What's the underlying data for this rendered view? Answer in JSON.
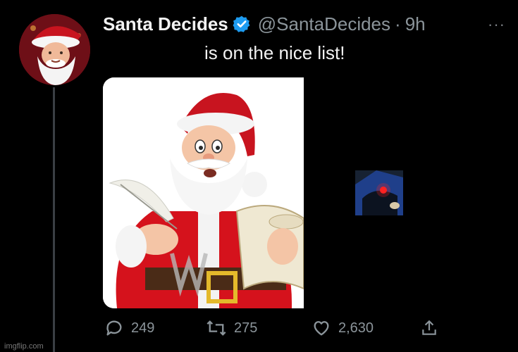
{
  "tweet": {
    "display_name": "Santa Decides",
    "handle": "@SantaDecides",
    "separator": "·",
    "time": "9h",
    "more_label": "···",
    "text": "is on the nice list!",
    "verified_icon": "verified-badge-icon"
  },
  "actions": {
    "replies": "249",
    "retweets": "275",
    "likes": "2,630"
  },
  "watermark": "imgflip.com",
  "colors": {
    "background": "#000000",
    "text": "#e7e9ea",
    "muted": "#8b949a",
    "verified": "#1d9bf0"
  }
}
